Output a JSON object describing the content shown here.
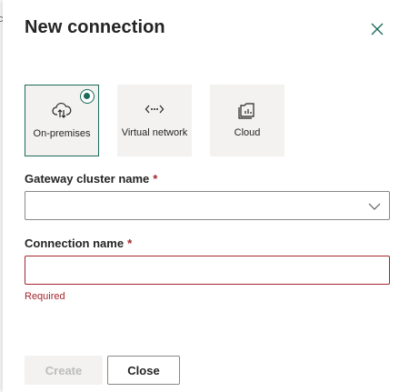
{
  "edge_glyph": "c",
  "dialog": {
    "title": "New connection",
    "close_icon": "close-icon"
  },
  "connection_types": [
    {
      "label": "On-premises",
      "icon": "cloud-upload-icon",
      "selected": true
    },
    {
      "label": "Virtual network",
      "icon": "virtual-network-icon",
      "selected": false
    },
    {
      "label": "Cloud",
      "icon": "cloud-storage-icon",
      "selected": false
    }
  ],
  "gateway": {
    "label": "Gateway cluster name",
    "required_mark": "*",
    "value": ""
  },
  "connection_name": {
    "label": "Connection name",
    "required_mark": "*",
    "value": "",
    "error": "Required"
  },
  "buttons": {
    "create": "Create",
    "close": "Close"
  },
  "colors": {
    "accent": "#1a6b5a",
    "error": "#a4262c",
    "tile_bg": "#f3f2f1"
  }
}
